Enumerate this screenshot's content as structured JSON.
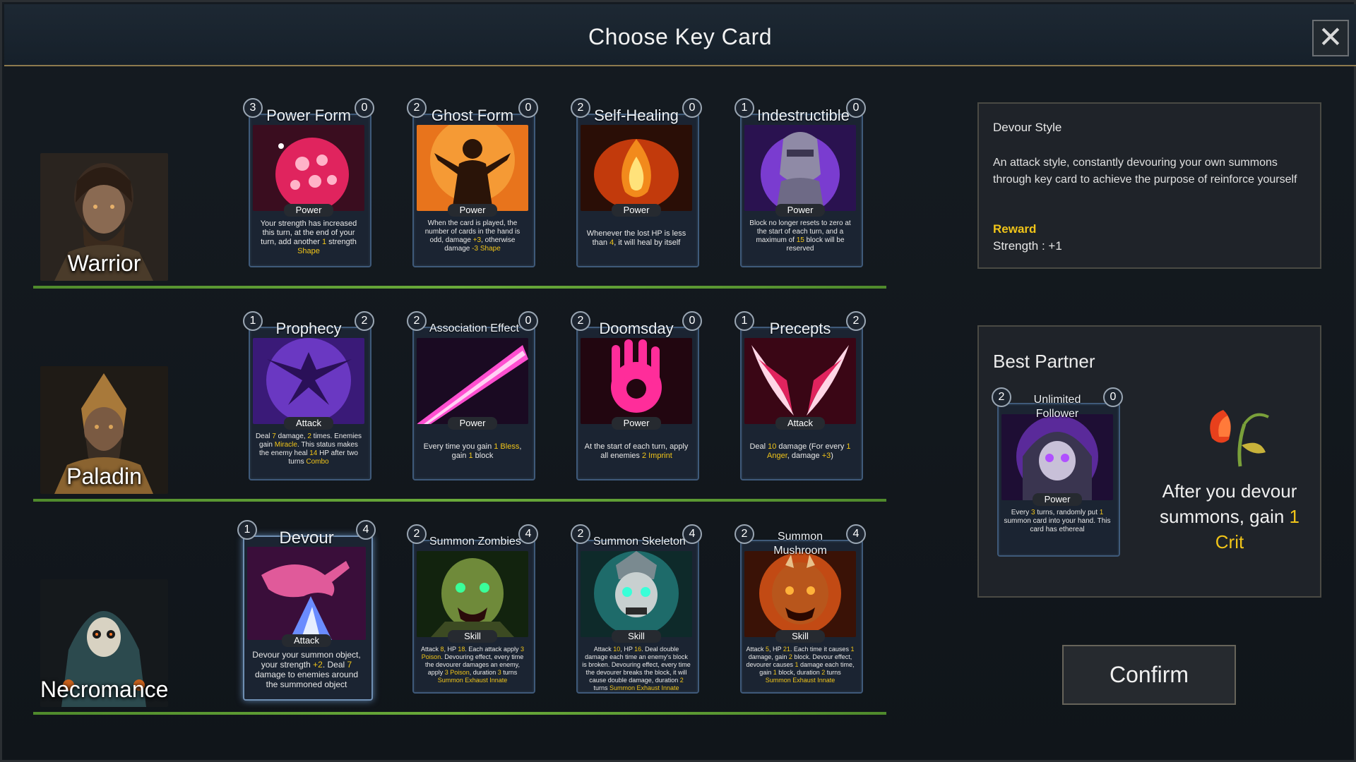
{
  "dialog": {
    "title": "Choose Key Card"
  },
  "heroes": [
    {
      "name": "Warrior"
    },
    {
      "name": "Paladin"
    },
    {
      "name": "Necromancer"
    }
  ],
  "cards": {
    "warrior": [
      {
        "name": "Power Form",
        "cost": "3",
        "count": "0",
        "type": "Power",
        "desc_a": "Your strength has increased this turn, at the end of your turn, add another ",
        "desc_b": "1",
        "desc_c": " strength ",
        "desc_d": "Shape"
      },
      {
        "name": "Ghost Form",
        "cost": "2",
        "count": "0",
        "type": "Power",
        "desc_a": "When the card is played, the number of cards in the hand is odd, damage ",
        "desc_b": "+3",
        "desc_c": ", otherwise damage ",
        "desc_d": "-3",
        "desc_e": "Shape"
      },
      {
        "name": "Self-Healing",
        "cost": "2",
        "count": "0",
        "type": "Power",
        "desc_a": "Whenever the lost HP is less than ",
        "desc_b": "4",
        "desc_c": ", it will heal by itself"
      },
      {
        "name": "Indestructible",
        "cost": "1",
        "count": "0",
        "type": "Power",
        "desc_a": "Block no longer resets to zero at the start of each turn, and a maximum of ",
        "desc_b": "15",
        "desc_c": " block will be reserved"
      }
    ],
    "paladin": [
      {
        "name": "Prophecy",
        "cost": "1",
        "count": "2",
        "type": "Attack",
        "desc_a": "Deal ",
        "desc_b": "7",
        "desc_c": " damage, ",
        "desc_d": "2",
        "desc_e": " times. Enemies gain ",
        "desc_f": "Miracle",
        "desc_g": ". This status makes the enemy heal ",
        "desc_h": "14",
        "desc_i": " HP after two turns ",
        "desc_j": "Combo"
      },
      {
        "name": "Association Effect",
        "cost": "2",
        "count": "0",
        "type": "Power",
        "desc_a": "Every time you gain ",
        "desc_b": "1 Bless",
        "desc_c": ", gain ",
        "desc_d": "1",
        "desc_e": " block"
      },
      {
        "name": "Doomsday",
        "cost": "2",
        "count": "0",
        "type": "Power",
        "desc_a": "At the start of each turn, apply all enemies ",
        "desc_b": "2 Imprint"
      },
      {
        "name": "Precepts",
        "cost": "1",
        "count": "2",
        "type": "Attack",
        "desc_a": "Deal ",
        "desc_b": "10",
        "desc_c": " damage (For every ",
        "desc_d": "1 Anger",
        "desc_e": ", damage ",
        "desc_f": "+3",
        "desc_g": ")"
      }
    ],
    "necromancer": [
      {
        "name": "Devour",
        "cost": "1",
        "count": "4",
        "type": "Attack",
        "desc_a": "Devour your summon object, your strength ",
        "desc_b": "+2",
        "desc_c": ". Deal ",
        "desc_d": "7",
        "desc_e": " damage to enemies around the summoned object"
      },
      {
        "name": "Summon Zombies",
        "cost": "2",
        "count": "4",
        "type": "Skill",
        "desc_a": "Attack ",
        "desc_b": "8",
        "desc_c": ", HP ",
        "desc_d": "18",
        "desc_e": ". Each attack apply ",
        "desc_f": "3 Poison",
        "desc_g": ". Devouring effect, every time the devourer damages an enemy, apply ",
        "desc_h": "3 Poison",
        "desc_i": ", duration ",
        "desc_j": "3",
        "desc_k": " turns ",
        "desc_l": "Summon Exhaust Innate"
      },
      {
        "name": "Summon Skeleton",
        "cost": "2",
        "count": "4",
        "type": "Skill",
        "desc_a": "Attack ",
        "desc_b": "10",
        "desc_c": ", HP ",
        "desc_d": "16",
        "desc_e": ". Deal double damage each time an enemy's block is broken. Devouring effect, every time the devourer breaks the block, it will cause double damage, duration ",
        "desc_f": "2",
        "desc_g": " turns ",
        "desc_h": "Summon Exhaust Innate"
      },
      {
        "name": "Summon Mushroom",
        "cost": "2",
        "count": "4",
        "type": "Skill",
        "desc_a": "Attack ",
        "desc_b": "5",
        "desc_c": ", HP ",
        "desc_d": "21",
        "desc_e": ". Each time it causes ",
        "desc_f": "1",
        "desc_g": " damage, gain ",
        "desc_h": "2",
        "desc_i": " block. Devour effect, devourer causes ",
        "desc_j": "1",
        "desc_k": " damage each time, gain ",
        "desc_l": "1",
        "desc_m": " block, duration ",
        "desc_n": "2",
        "desc_o": " turns ",
        "desc_p": "Summon Exhaust Innate"
      }
    ]
  },
  "style_panel": {
    "title": "Devour Style",
    "description": "An attack style, constantly devouring your own summons through key card to achieve the purpose of reinforce yourself",
    "reward_label": "Reward",
    "reward_value": "Strength : +1"
  },
  "partner_panel": {
    "title": "Best Partner",
    "card": {
      "name": "Unlimited Follower",
      "cost": "2",
      "count": "0",
      "type": "Power",
      "desc_a": "Every ",
      "desc_b": "3",
      "desc_c": " turns, randomly put ",
      "desc_d": "1",
      "desc_e": " summon card into your hand. This card has ethereal"
    },
    "text_a": "After you devour summons, gain ",
    "text_b": "1 Crit"
  },
  "confirm_label": "Confirm",
  "colors": {
    "accent_yellow": "#f0c419",
    "row_line_green": "#6aab3a",
    "header_gold": "#8d7a4e"
  }
}
